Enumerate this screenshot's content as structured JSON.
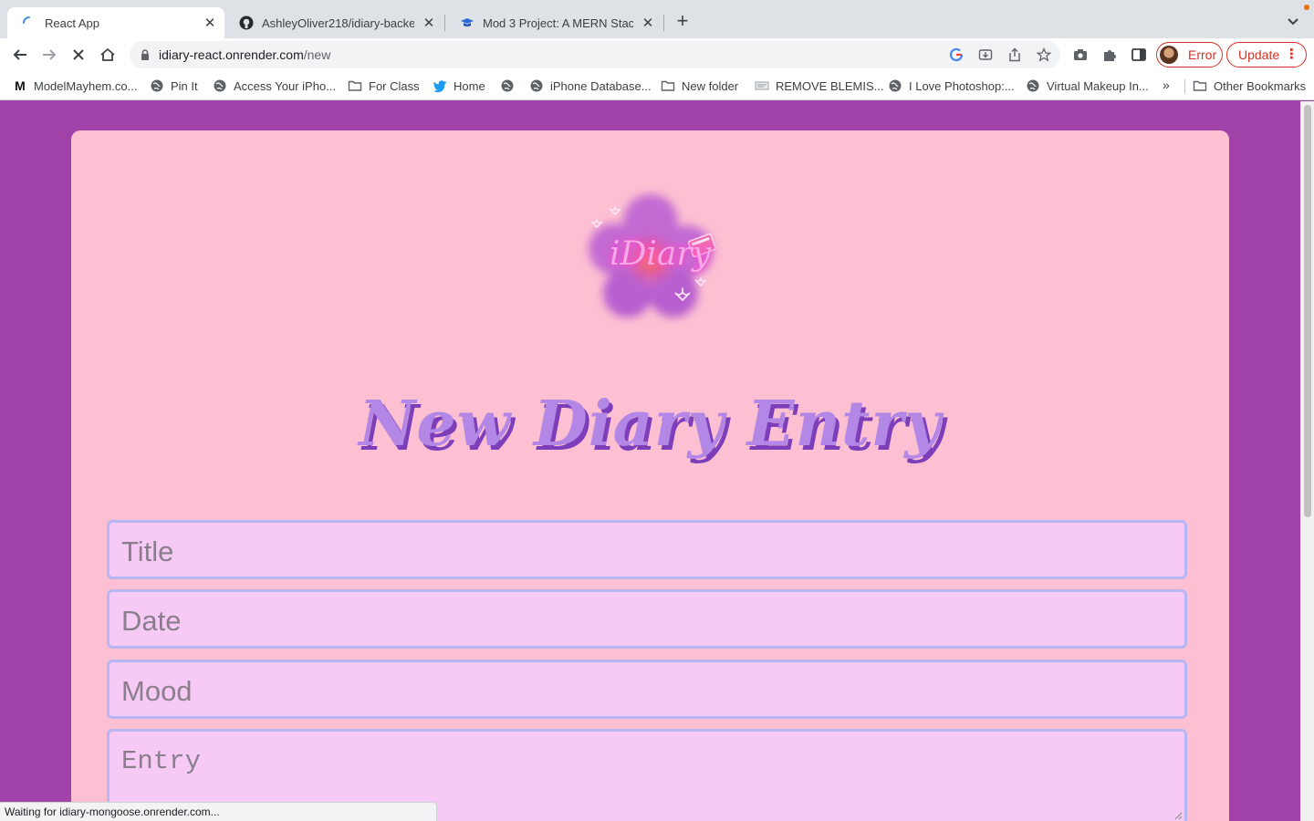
{
  "browser": {
    "tabs": [
      {
        "title": "React App",
        "active": true,
        "favicon": "loading-spinner-icon"
      },
      {
        "title": "AshleyOliver218/idiary-backend",
        "active": false,
        "favicon": "github-icon"
      },
      {
        "title": "Mod 3 Project: A MERN Stack /",
        "active": false,
        "favicon": "grad-cap-icon"
      }
    ],
    "new_tab_label": "+",
    "url_host": "idiary-react.onrender.com",
    "url_path": "/new",
    "profile_label": "Error",
    "update_label": "Update"
  },
  "bookmarks": {
    "items": [
      {
        "label": "ModelMayhem.co...",
        "icon": "modelmayhem-icon"
      },
      {
        "label": "Pin It",
        "icon": "globe-icon"
      },
      {
        "label": "Access Your iPho...",
        "icon": "globe-icon"
      },
      {
        "label": "For Class",
        "icon": "folder-icon"
      },
      {
        "label": "Home",
        "icon": "twitter-bird-icon"
      },
      {
        "label": "",
        "icon": "globe-icon"
      },
      {
        "label": "iPhone Database...",
        "icon": "globe-icon"
      },
      {
        "label": "New folder",
        "icon": "folder-icon"
      },
      {
        "label": "REMOVE BLEMIS...",
        "icon": "page-icon"
      },
      {
        "label": "I Love Photoshop:...",
        "icon": "globe-icon"
      },
      {
        "label": "Virtual Makeup In...",
        "icon": "globe-icon"
      }
    ],
    "overflow_label": "»",
    "other_label": "Other Bookmarks"
  },
  "page": {
    "logo_text": "iDiary",
    "heading": "New Diary Entry",
    "form": {
      "title_placeholder": "Title",
      "date_placeholder": "Date",
      "mood_placeholder": "Mood",
      "entry_placeholder": "Entry"
    },
    "colors": {
      "page_bg": "#a042a8",
      "card_bg": "#fdc0d2",
      "field_bg": "#f7caf6",
      "field_border": "#b7b6f3",
      "heading": "#b387e6",
      "heading_shadow": "#7c3fb9"
    }
  },
  "status_text": "Waiting for idiary-mongoose.onrender.com..."
}
